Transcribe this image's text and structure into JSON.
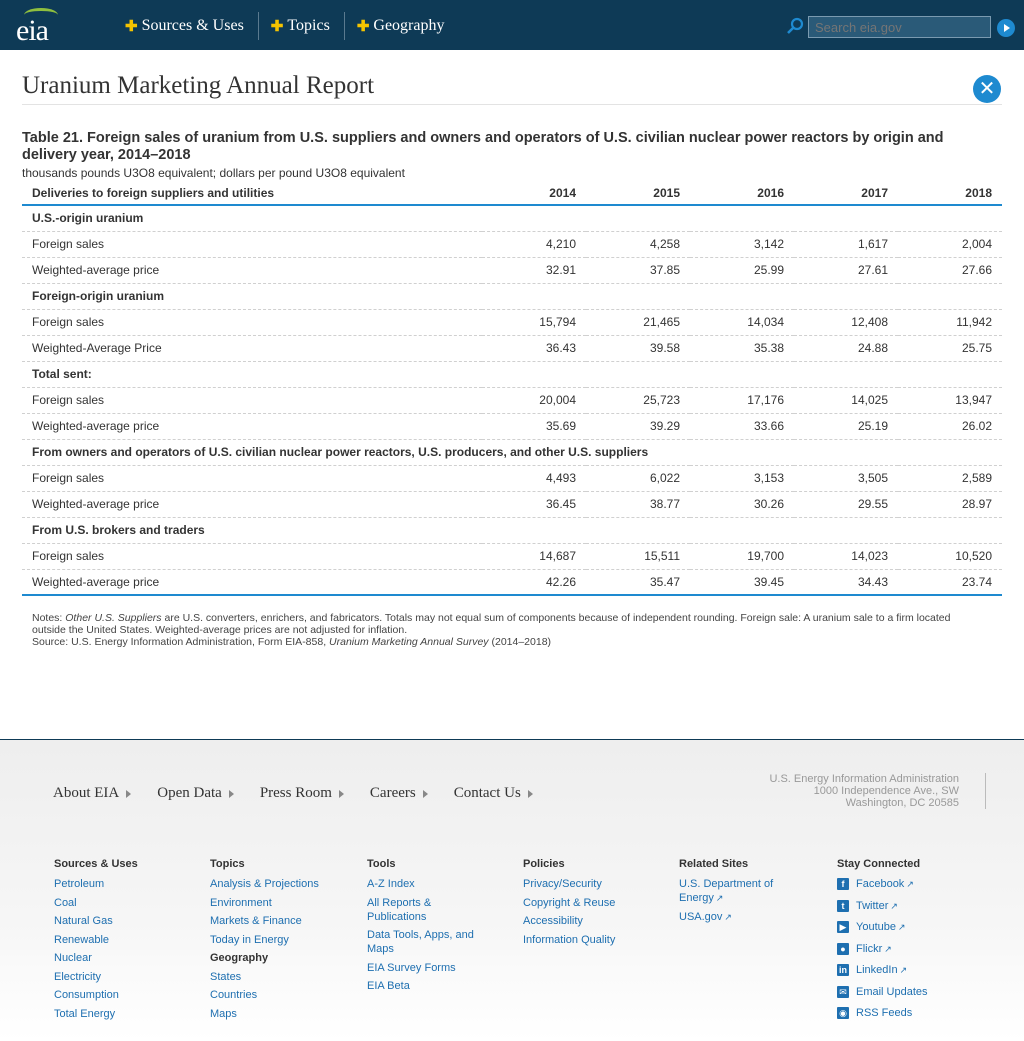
{
  "header": {
    "logo_text": "eia",
    "nav": [
      "Sources & Uses",
      "Topics",
      "Geography"
    ],
    "search_placeholder": "Search eia.gov"
  },
  "page": {
    "title": "Uranium Marketing Annual Report"
  },
  "table": {
    "title": "Table 21. Foreign sales of uranium from U.S. suppliers and owners and operators of U.S. civilian nuclear power reactors by origin and delivery year, 2014–2018",
    "units": "thousands pounds U3O8 equivalent; dollars per pound U3O8 equivalent",
    "columns": [
      "Deliveries to foreign suppliers and utilities",
      "2014",
      "2015",
      "2016",
      "2017",
      "2018"
    ],
    "rows": [
      {
        "type": "section",
        "label": "U.S.-origin uranium"
      },
      {
        "type": "data",
        "label": "Foreign sales",
        "values": [
          "4,210",
          "4,258",
          "3,142",
          "1,617",
          "2,004"
        ]
      },
      {
        "type": "data",
        "label": "Weighted-average price",
        "values": [
          "32.91",
          "37.85",
          "25.99",
          "27.61",
          "27.66"
        ]
      },
      {
        "type": "section",
        "label": "Foreign-origin uranium"
      },
      {
        "type": "data",
        "label": "Foreign sales",
        "values": [
          "15,794",
          "21,465",
          "14,034",
          "12,408",
          "11,942"
        ]
      },
      {
        "type": "data",
        "label": "Weighted-Average Price",
        "values": [
          "36.43",
          "39.58",
          "35.38",
          "24.88",
          "25.75"
        ]
      },
      {
        "type": "section",
        "label": "Total sent:"
      },
      {
        "type": "data",
        "label": "Foreign sales",
        "values": [
          "20,004",
          "25,723",
          "17,176",
          "14,025",
          "13,947"
        ]
      },
      {
        "type": "data",
        "label": "Weighted-average price",
        "values": [
          "35.69",
          "39.29",
          "33.66",
          "25.19",
          "26.02"
        ]
      },
      {
        "type": "section",
        "label": "From owners and operators of U.S. civilian nuclear power reactors, U.S. producers, and other U.S. suppliers"
      },
      {
        "type": "data",
        "label": "Foreign sales",
        "values": [
          "4,493",
          "6,022",
          "3,153",
          "3,505",
          "2,589"
        ]
      },
      {
        "type": "data",
        "label": "Weighted-average price",
        "values": [
          "36.45",
          "38.77",
          "30.26",
          "29.55",
          "28.97"
        ]
      },
      {
        "type": "section",
        "label": "From U.S. brokers and traders"
      },
      {
        "type": "data",
        "label": "Foreign sales",
        "values": [
          "14,687",
          "15,511",
          "19,700",
          "14,023",
          "10,520"
        ]
      },
      {
        "type": "data",
        "label": "Weighted-average price",
        "values": [
          "42.26",
          "35.47",
          "39.45",
          "34.43",
          "23.74"
        ]
      }
    ]
  },
  "notes": {
    "notes_prefix": "Notes: ",
    "notes_italic": "Other U.S. Suppliers",
    "notes_rest": " are U.S. converters, enrichers, and fabricators. Totals may not equal sum of components because of independent rounding. Foreign sale: A uranium sale to a firm located outside the United States. Weighted-average prices are not adjusted for inflation.",
    "source_prefix": "Source: U.S. Energy Information Administration, Form EIA-858, ",
    "source_italic": "Uranium Marketing Annual Survey",
    "source_suffix": " (2014–2018)"
  },
  "footer": {
    "nav": [
      "About EIA",
      "Open Data",
      "Press Room",
      "Careers",
      "Contact Us"
    ],
    "address": [
      "U.S. Energy Information Administration",
      "1000 Independence Ave., SW",
      "Washington, DC 20585"
    ],
    "columns": {
      "sources": {
        "heading": "Sources & Uses",
        "links": [
          "Petroleum",
          "Coal",
          "Natural Gas",
          "Renewable",
          "Nuclear",
          "Electricity",
          "Consumption",
          "Total Energy"
        ]
      },
      "topics": {
        "heading": "Topics",
        "links": [
          "Analysis & Projections",
          "Environment",
          "Markets & Finance",
          "Today in Energy"
        ],
        "subheading": "Geography",
        "sublinks": [
          "States",
          "Countries",
          "Maps"
        ]
      },
      "tools": {
        "heading": "Tools",
        "links": [
          "A-Z Index",
          "All Reports & Publications",
          "Data Tools, Apps, and Maps",
          "EIA Survey Forms",
          "EIA Beta"
        ]
      },
      "policies": {
        "heading": "Policies",
        "links": [
          "Privacy/Security",
          "Copyright & Reuse",
          "Accessibility",
          "Information Quality"
        ]
      },
      "related": {
        "heading": "Related Sites",
        "links": [
          "U.S. Department of Energy",
          "USA.gov"
        ]
      },
      "social": {
        "heading": "Stay Connected",
        "links": [
          "Facebook",
          "Twitter",
          "Youtube",
          "Flickr",
          "LinkedIn",
          "Email Updates",
          "RSS Feeds"
        ]
      }
    }
  },
  "colors": {
    "header_bg": "#0e3a56",
    "accent": "#1e8ad0",
    "plus": "#f5c400",
    "link": "#1e6fb0"
  }
}
